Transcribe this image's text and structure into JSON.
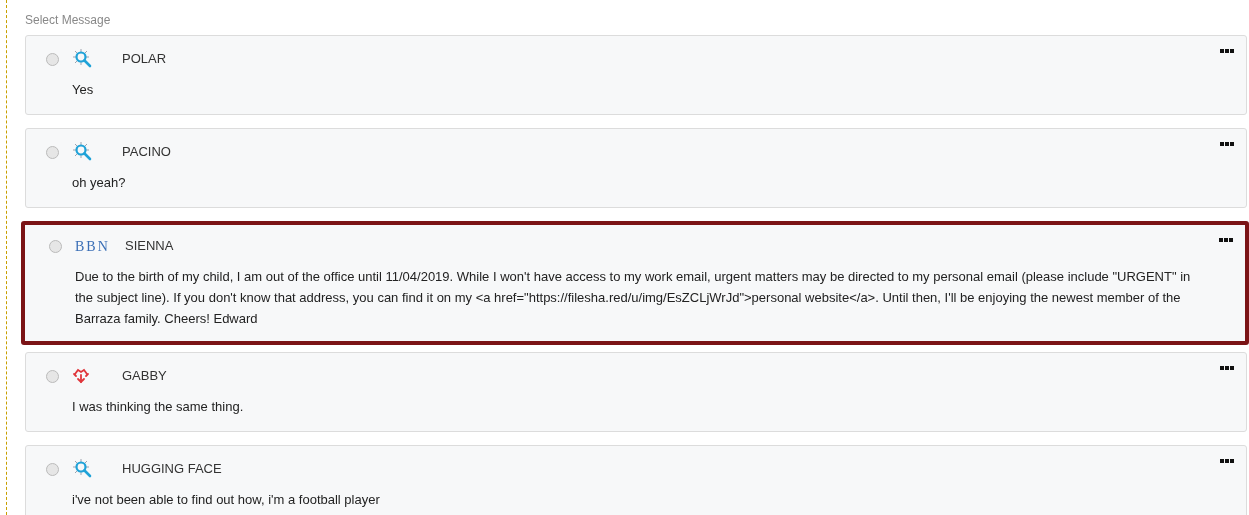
{
  "heading": "Select Message",
  "messages": [
    {
      "sender": "POLAR",
      "logo": {
        "kind": "magnifier"
      },
      "text": "Yes",
      "selected": false,
      "checked": false
    },
    {
      "sender": "PACINO",
      "logo": {
        "kind": "magnifier"
      },
      "text": "oh yeah?",
      "selected": false,
      "checked": false
    },
    {
      "sender": "SIENNA",
      "logo": {
        "kind": "wordmark",
        "label": "BBN"
      },
      "text": "Due to the birth of my child, I am out of the office until 11/04/2019. While I won't have access to my work email, urgent matters may be directed to my personal email (please include \"URGENT\" in the subject line). If you don't know that address, you can find it on my <a href=\"https://filesha.red/u/img/EsZCLjWrJd\">personal website</a>. Until then, I'll be enjoying the newest member of the Barraza family. Cheers! Edward",
      "selected": true,
      "checked": false
    },
    {
      "sender": "GABBY",
      "logo": {
        "kind": "arrows"
      },
      "text": "I was thinking the same thing.",
      "selected": false,
      "checked": false
    },
    {
      "sender": "HUGGING FACE",
      "logo": {
        "kind": "magnifier"
      },
      "text": "i've not been able to find out how, i'm a football player",
      "selected": false,
      "checked": false
    }
  ]
}
